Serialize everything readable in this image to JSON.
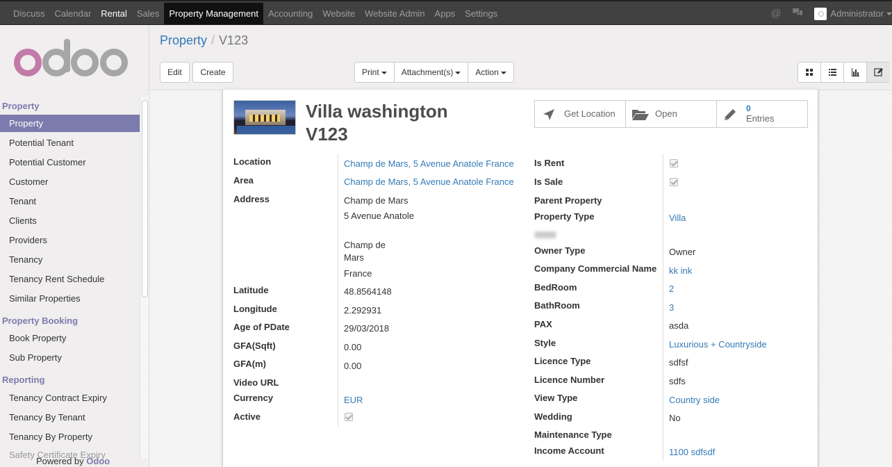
{
  "topnav": {
    "items": [
      "Discuss",
      "Calendar",
      "Rental",
      "Sales",
      "Property Management",
      "Accounting",
      "Website",
      "Website Admin",
      "Apps",
      "Settings"
    ],
    "user": "Administrator"
  },
  "sidebar": {
    "sections": [
      {
        "title": "Property",
        "items": [
          "Property",
          "Potential Tenant",
          "Potential Customer",
          "Customer",
          "Tenant",
          "Clients",
          "Providers",
          "Tenancy",
          "Tenancy Rent Schedule",
          "Similar Properties"
        ]
      },
      {
        "title": "Property Booking",
        "items": [
          "Book Property",
          "Sub Property"
        ]
      },
      {
        "title": "Reporting",
        "items": [
          "Tenancy Contract Expiry",
          "Tenancy By Tenant",
          "Tenancy By Property",
          "Safety Certificate Expiry"
        ]
      }
    ],
    "powered_prefix": "Powered by",
    "powered_brand": "Odoo"
  },
  "breadcrumb": {
    "parent": "Property",
    "separator": "/",
    "current": "V123"
  },
  "buttons": {
    "edit": "Edit",
    "create": "Create",
    "print": "Print",
    "attachments": "Attachment(s)",
    "action": "Action"
  },
  "form": {
    "name": "Villa washington",
    "code": "V123",
    "stat_buttons": {
      "location": "Get Location",
      "open": "Open",
      "entries_count": "0",
      "entries_label": "Entries"
    },
    "left": {
      "location": {
        "label": "Location",
        "value": "Champ de Mars, 5 Avenue Anatole France"
      },
      "area": {
        "label": "Area",
        "value": "Champ de Mars, 5 Avenue Anatole France"
      },
      "address": {
        "label": "Address",
        "line1": "Champ de Mars",
        "line2": "5 Avenue Anatole",
        "city1": "Champ de",
        "city2": "Mars",
        "country": "France"
      },
      "latitude": {
        "label": "Latitude",
        "value": "48.8564148"
      },
      "longitude": {
        "label": "Longitude",
        "value": "2.292931"
      },
      "age": {
        "label": "Age of PDate",
        "value": "29/03/2018"
      },
      "gfa_sqft": {
        "label": "GFA(Sqft)",
        "value": "0.00"
      },
      "gfa_m": {
        "label": "GFA(m)",
        "value": "0.00"
      },
      "video": {
        "label": "Video URL",
        "value": ""
      },
      "currency": {
        "label": "Currency",
        "value": "EUR"
      },
      "active": {
        "label": "Active",
        "checked": true
      }
    },
    "right": {
      "is_rent": {
        "label": "Is Rent",
        "checked": true
      },
      "is_sale": {
        "label": "Is Sale",
        "checked": true
      },
      "parent_property": {
        "label": "Parent Property",
        "value": ""
      },
      "property_type": {
        "label": "Property Type",
        "value": "Villa"
      },
      "owner_type": {
        "label": "Owner Type",
        "value": "Owner"
      },
      "company_name": {
        "label": "Company Commercial Name",
        "value": "kk ink"
      },
      "bedroom": {
        "label": "BedRoom",
        "value": "2"
      },
      "bathroom": {
        "label": "BathRoom",
        "value": "3"
      },
      "pax": {
        "label": "PAX",
        "value": "asda"
      },
      "style": {
        "label": "Style",
        "value": "Luxurious + Countryside"
      },
      "licence_type": {
        "label": "Licence Type",
        "value": "sdfsf"
      },
      "licence_number": {
        "label": "Licence Number",
        "value": "sdfs"
      },
      "view_type": {
        "label": "View Type",
        "value": "Country side"
      },
      "wedding": {
        "label": "Wedding",
        "value": "No"
      },
      "maintenance_type": {
        "label": "Maintenance Type",
        "value": ""
      },
      "income_account": {
        "label": "Income Account",
        "value": "1100 sdfsdf"
      }
    }
  }
}
